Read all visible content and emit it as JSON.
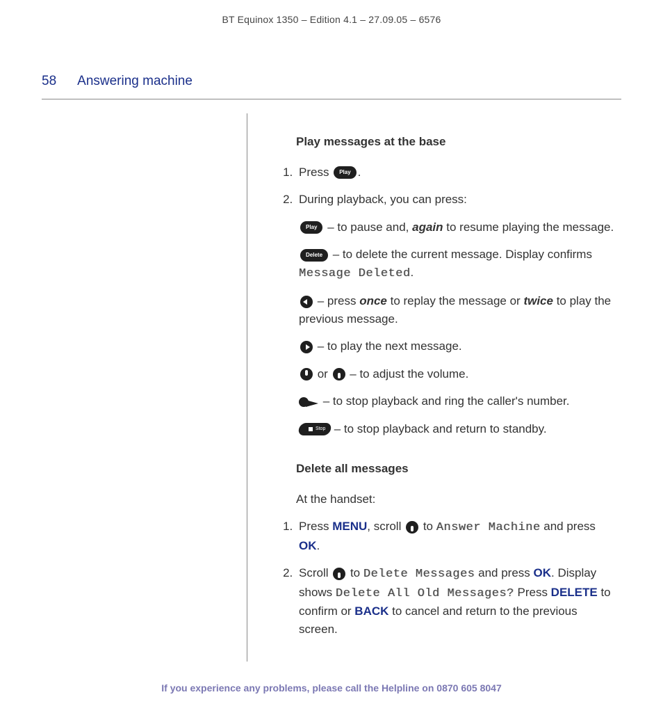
{
  "header": "BT Equinox 1350 – Edition 4.1 – 27.09.05 – 6576",
  "page_number": "58",
  "section_title": "Answering machine",
  "subhead1": "Play messages at the base",
  "step1": {
    "prefix": "Press ",
    "btn": "Play",
    "suffix": "."
  },
  "step2": {
    "intro": "During playback, you can press:",
    "items": [
      {
        "icon": "play-pill",
        "icon_label": "Play",
        "t1": " – to pause and, ",
        "em": "again",
        "t2": " to resume playing the message."
      },
      {
        "icon": "delete-pill",
        "icon_label": "Delete",
        "t1": " – to delete the current message. Display confirms ",
        "lcd": "Message Deleted",
        "t2": "."
      },
      {
        "icon": "arrow-left",
        "t1": " – press ",
        "em": "once",
        "t2": " to replay the message or ",
        "em2": "twice",
        "t3": " to play the previous message."
      },
      {
        "icon": "arrow-right",
        "t1": " – to play the next message."
      },
      {
        "icon": "vol-up",
        "icon2": "vol-down",
        "joiner": " or ",
        "t1": " – to adjust the volume."
      },
      {
        "icon": "dial",
        "t1": " – to stop playback and ring the caller's number."
      },
      {
        "icon": "stop",
        "icon_label": "Stop",
        "t1": " – to stop playback and return to standby."
      }
    ]
  },
  "subhead2": "Delete all messages",
  "intro2": "At the handset:",
  "del_step1": {
    "t1": "Press ",
    "k1": "MENU",
    "t2": ", scroll ",
    "t3": " to ",
    "lcd1": "Answer Machine",
    "t4": " and press ",
    "k2": "OK",
    "t5": "."
  },
  "del_step2": {
    "t1": "Scroll ",
    "t2": " to ",
    "lcd1": "Delete Messages",
    "t3": " and press ",
    "k1": "OK",
    "t4": ". Display shows ",
    "lcd2": "Delete All Old Messages?",
    "t5": " Press ",
    "k2": "DELETE",
    "t6": " to confirm or ",
    "k3": "BACK",
    "t7": " to cancel and return to the previous screen."
  },
  "footer": {
    "text": "If you experience any problems, please call the Helpline on ",
    "phone": "0870 605 8047"
  }
}
